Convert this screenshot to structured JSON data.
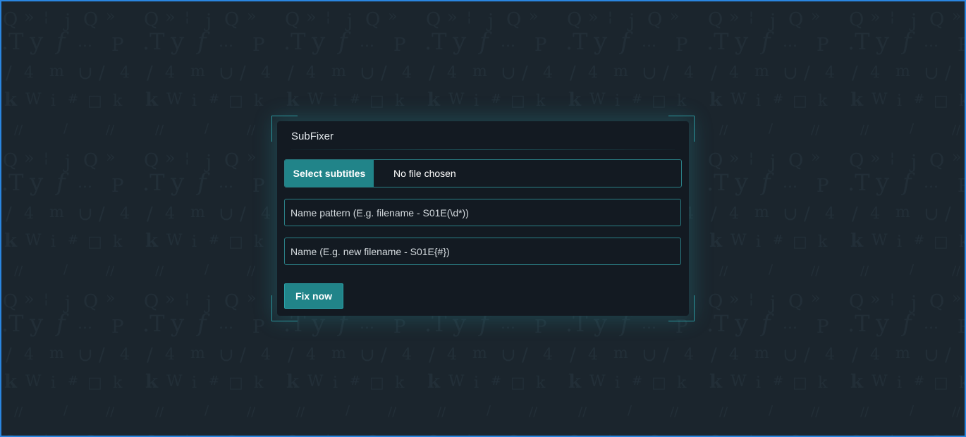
{
  "app": {
    "title": "SubFixer"
  },
  "form": {
    "file_button_label": "Select subtitles",
    "file_status": "No file chosen",
    "pattern_placeholder": "Name pattern (E.g. filename - S01E(\\d*))",
    "name_placeholder": "Name (E.g. new filename - S01E{#})",
    "submit_label": "Fix now"
  },
  "colors": {
    "background": "#1b252d",
    "card": "#131a22",
    "accent": "#218489",
    "accent_border": "#2a7f86",
    "window_border": "#2a86e0"
  }
}
